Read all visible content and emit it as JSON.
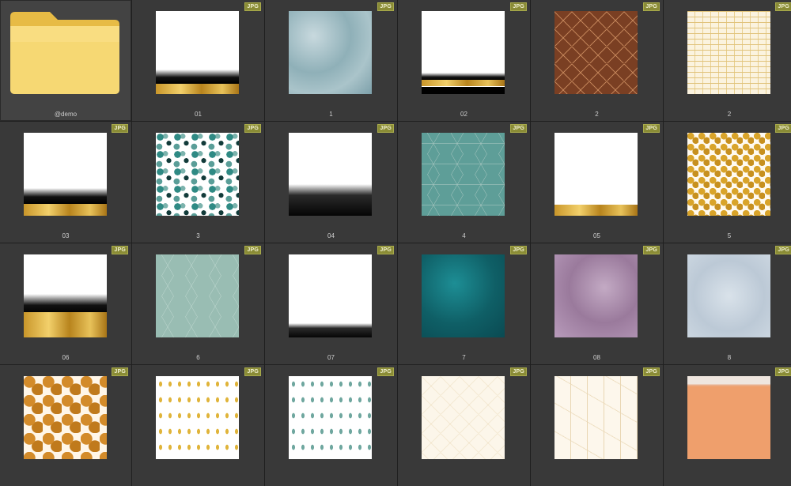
{
  "window": {
    "title": ""
  },
  "thumbnails": [
    {
      "label": "@demo",
      "type": "folder",
      "badge": "",
      "texture": "folder",
      "selected": true
    },
    {
      "label": "01",
      "type": "file",
      "badge": "JPG",
      "texture": "white-gold-01"
    },
    {
      "label": "1",
      "type": "file",
      "badge": "JPG",
      "texture": "blue-marble"
    },
    {
      "label": "02",
      "type": "file",
      "badge": "JPG",
      "texture": "white-gold-02"
    },
    {
      "label": "2",
      "type": "file",
      "badge": "JPG",
      "texture": "brown-geo"
    },
    {
      "label": "2",
      "type": "file",
      "badge": "JPG",
      "texture": "gold-lines"
    },
    {
      "label": "03",
      "type": "file",
      "badge": "JPG",
      "texture": "white-gold-03"
    },
    {
      "label": "3",
      "type": "file",
      "badge": "JPG",
      "texture": "teal-shapes"
    },
    {
      "label": "04",
      "type": "file",
      "badge": "JPG",
      "texture": "white-black-04"
    },
    {
      "label": "4",
      "type": "file",
      "badge": "JPG",
      "texture": "teal-geo"
    },
    {
      "label": "05",
      "type": "file",
      "badge": "JPG",
      "texture": "white-gold-05"
    },
    {
      "label": "5",
      "type": "file",
      "badge": "JPG",
      "texture": "gold-cells"
    },
    {
      "label": "06",
      "type": "file",
      "badge": "JPG",
      "texture": "white-gold-06"
    },
    {
      "label": "6",
      "type": "file",
      "badge": "JPG",
      "texture": "mint-geo"
    },
    {
      "label": "07",
      "type": "file",
      "badge": "JPG",
      "texture": "white-black-07"
    },
    {
      "label": "7",
      "type": "file",
      "badge": "JPG",
      "texture": "deep-teal"
    },
    {
      "label": "08",
      "type": "file",
      "badge": "JPG",
      "texture": "lilac"
    },
    {
      "label": "8",
      "type": "file",
      "badge": "JPG",
      "texture": "pale-blue"
    },
    {
      "label": "",
      "type": "file",
      "badge": "JPG",
      "texture": "gold-leaves"
    },
    {
      "label": "",
      "type": "file",
      "badge": "JPG",
      "texture": "yellow-fern"
    },
    {
      "label": "",
      "type": "file",
      "badge": "JPG",
      "texture": "teal-fern"
    },
    {
      "label": "",
      "type": "file",
      "badge": "JPG",
      "texture": "cream-geo"
    },
    {
      "label": "",
      "type": "file",
      "badge": "JPG",
      "texture": "cream-lines"
    },
    {
      "label": "",
      "type": "file",
      "badge": "JPG",
      "texture": "wood"
    }
  ],
  "colors": {
    "background": "#1f1f1f",
    "cell": "#393939",
    "badge": "#8a8c36",
    "label": "#cfcfcf",
    "folder": "#f4d36b"
  },
  "icons": {
    "folder": "folder-icon",
    "badge": "jpg-badge-icon"
  }
}
